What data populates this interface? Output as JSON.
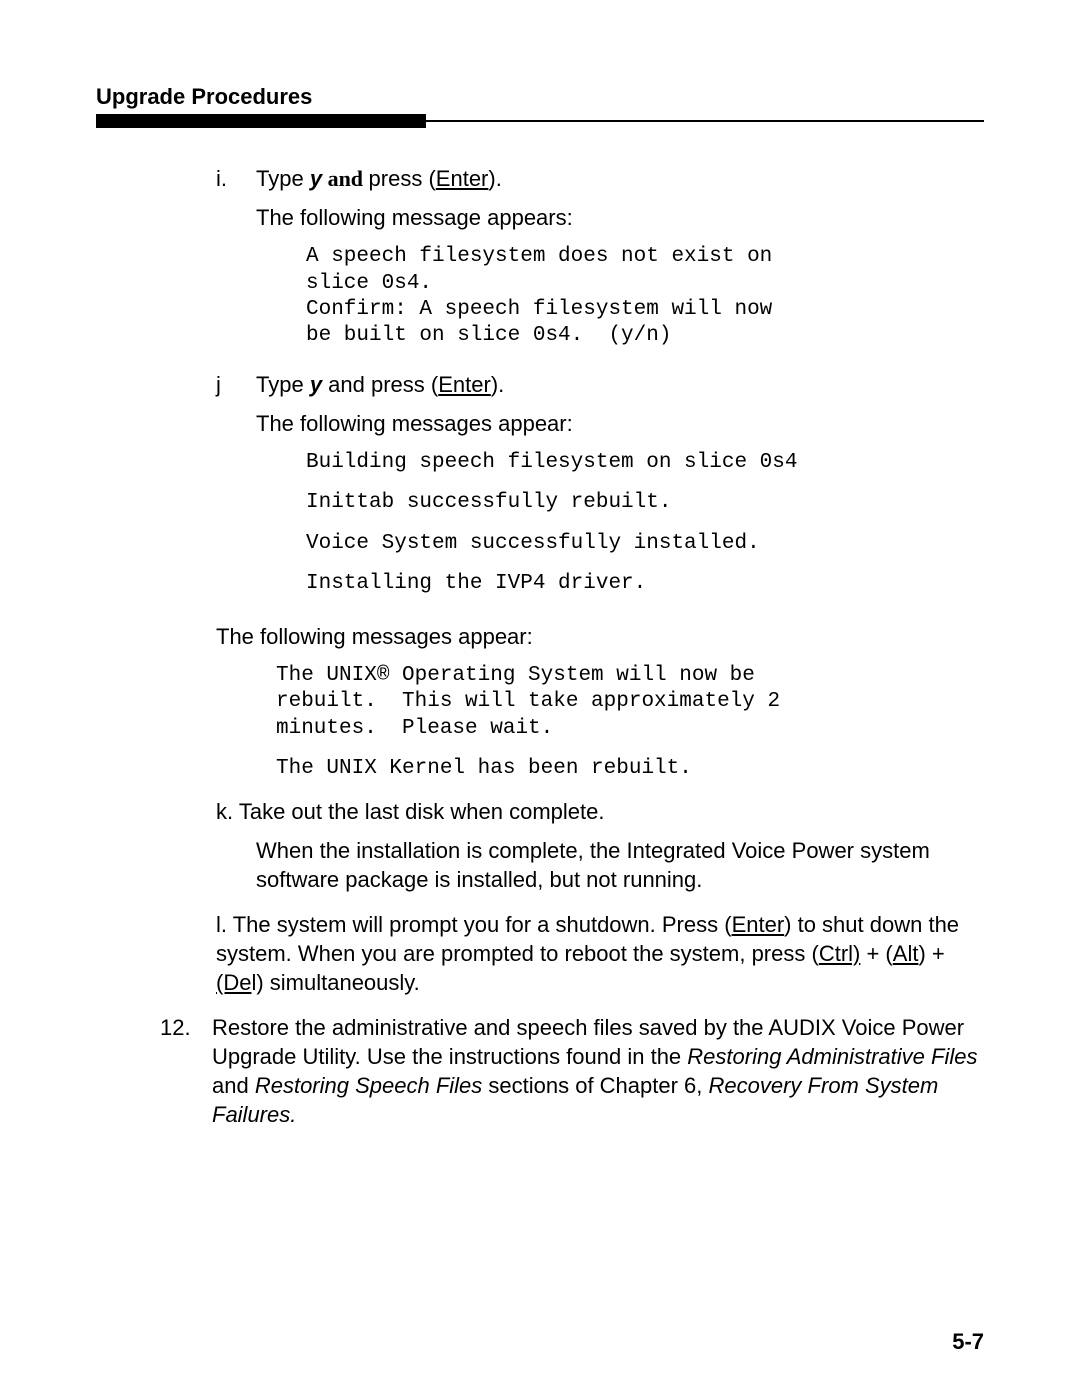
{
  "header": {
    "title": "Upgrade  Procedures"
  },
  "step_i": {
    "marker": "i.",
    "text_pre": "Type ",
    "key_y": "y",
    "and_word": " and ",
    "press_word": "press (",
    "enter_key": "Enter",
    "text_post": ").",
    "msg_intro": "The following message appears:",
    "mono": "A speech filesystem does not exist on\nslice 0s4.\nConfirm: A speech filesystem will now\nbe built on slice 0s4.  (y/n)"
  },
  "step_j": {
    "marker": "j",
    "text_pre": "Type ",
    "key_y": "y",
    "mid": " and press (",
    "enter_key": "Enter",
    "text_post": ").",
    "msg_intro": "The following messages appear:",
    "mono1": "Building speech filesystem on slice 0s4",
    "mono2": "Inittab successfully rebuilt.",
    "mono3": "Voice System successfully installed.",
    "mono4": "Installing the IVP4 driver.",
    "msg_intro2": "The following messages appear:",
    "mono5": "The UNIX® Operating System will now be\nrebuilt.  This will take approximately 2\nminutes.  Please wait.",
    "mono6": "The UNIX Kernel has been rebuilt."
  },
  "step_k": {
    "line": "k. Take out the last disk when complete.",
    "body": "When the installation is complete, the Integrated Voice Power system software package is installed, but not running."
  },
  "step_l": {
    "pre": "l. The system will prompt you for a shutdown. Press (",
    "enter_key": "Enter",
    "mid1": ") to shut down the system. When you are prompted to reboot the system, press (",
    "ctrl_key": "Ctrl)",
    "plus1": " +  (",
    "alt_key": "Alt",
    "mid2": ")  +  ",
    "del_key": " (De",
    "post": "l) simultaneously."
  },
  "step_12": {
    "num": "12.",
    "pre": "Restore the administrative and speech files saved by the AUDIX Voice Power Upgrade Utility. Use the instructions found in the ",
    "it1": "Restoring Administrative Files",
    "and": " and ",
    "it2": "Restoring Speech Files",
    "mid": " sections of Chapter 6, ",
    "it3": "Recovery From System Failures.",
    "post": ""
  },
  "page_num": "5-7"
}
